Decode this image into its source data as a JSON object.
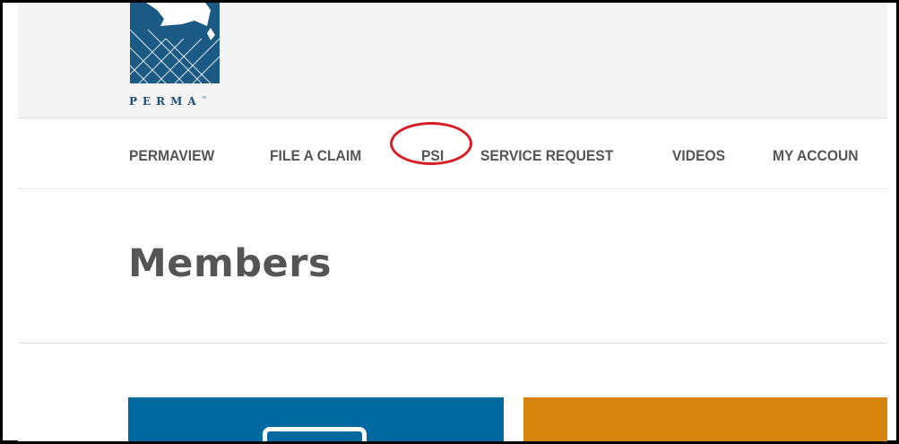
{
  "header": {
    "logo_text": "PERMA",
    "logo_mark": "™"
  },
  "nav": {
    "items": [
      {
        "label": "PERMAVIEW"
      },
      {
        "label": "FILE A CLAIM"
      },
      {
        "label": "PSI"
      },
      {
        "label": "SERVICE REQUEST"
      },
      {
        "label": "VIDEOS"
      },
      {
        "label": "MY ACCOUN"
      }
    ],
    "highlighted": "PSI"
  },
  "page": {
    "title": "Members"
  },
  "tiles": [
    {
      "color": "#00699f",
      "icon": "laptop-icon"
    },
    {
      "color": "#d4850a"
    }
  ],
  "colors": {
    "logo_blue": "#1a5a85",
    "highlight_circle": "#d81c24",
    "nav_text": "#555555"
  }
}
